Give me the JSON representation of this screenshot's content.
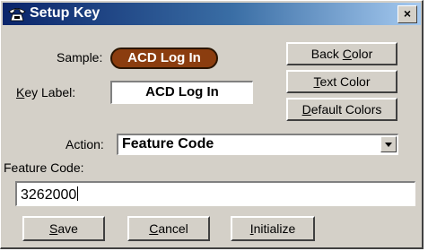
{
  "window": {
    "title": "Setup Key",
    "close_label": "×"
  },
  "sample": {
    "label": "Sample:",
    "pill_text": "ACD Log In",
    "pill_color": "#8b3d0f"
  },
  "key_label": {
    "label": "Key Label:",
    "value": "ACD Log In"
  },
  "color_buttons": {
    "back_color": "Back Color",
    "text_color": "Text Color",
    "default_colors": "Default Colors"
  },
  "action": {
    "label": "Action:",
    "selected": "Feature Code"
  },
  "feature_code": {
    "label": "Feature Code:",
    "value": "3262000"
  },
  "footer": {
    "save": "Save",
    "cancel": "Cancel",
    "initialize": "Initialize"
  }
}
